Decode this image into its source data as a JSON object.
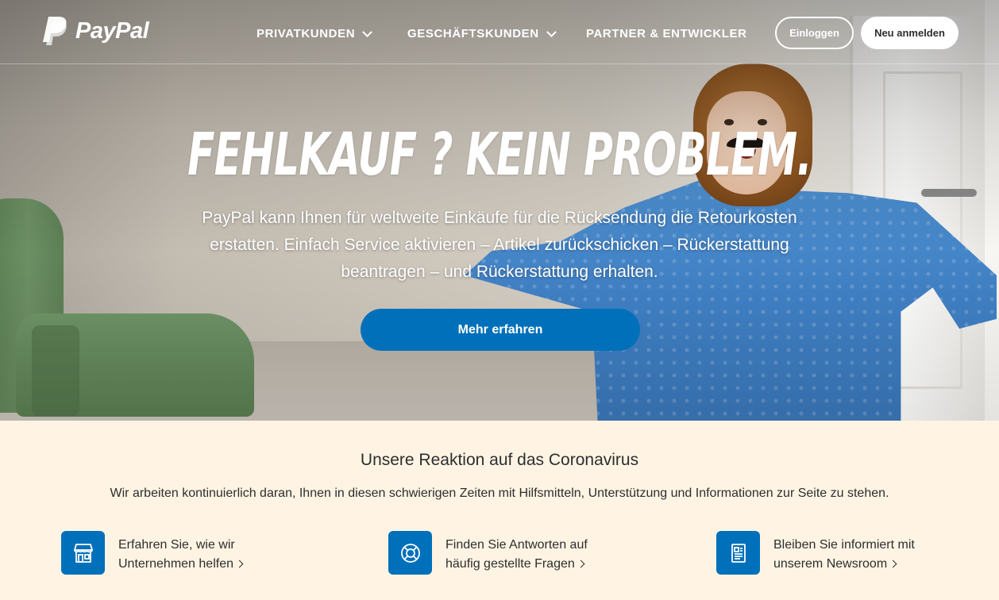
{
  "header": {
    "brand": "PayPal",
    "nav": [
      {
        "label": "PRIVATKUNDEN",
        "has_dropdown": true
      },
      {
        "label": "GESCHÄFTSKUNDEN",
        "has_dropdown": true
      },
      {
        "label": "PARTNER & ENTWICKLER",
        "has_dropdown": false
      }
    ],
    "login_label": "Einloggen",
    "signup_label": "Neu anmelden"
  },
  "hero": {
    "title": "FEHLKAUF ? KEIN PROBLEM.",
    "text": "PayPal kann Ihnen für weltweite Einkäufe für die Rücksendung die Retourkosten erstatten. Einfach Service aktivieren – Artikel zurückschicken – Rückerstattung beantragen – und Rückerstattung erhalten.",
    "cta_label": "Mehr erfahren"
  },
  "corona": {
    "title": "Unsere Reaktion auf das Coronavirus",
    "subtitle": "Wir arbeiten kontinuierlich daran, Ihnen in diesen schwierigen Zeiten mit Hilfsmitteln, Unterstützung und Informationen zur Seite zu stehen.",
    "cards": [
      {
        "icon": "storefront-icon",
        "line1": "Erfahren Sie, wie wir",
        "line2": "Unternehmen helfen"
      },
      {
        "icon": "lifebuoy-icon",
        "line1": "Finden Sie Antworten auf",
        "line2": "häufig gestellte Fragen"
      },
      {
        "icon": "newspaper-icon",
        "line1": "Bleiben Sie informiert mit",
        "line2": "unserem Newsroom"
      }
    ]
  },
  "colors": {
    "primary_blue": "#0070ba",
    "section_background": "#fff4e3",
    "text_dark": "#2c2e2f"
  }
}
